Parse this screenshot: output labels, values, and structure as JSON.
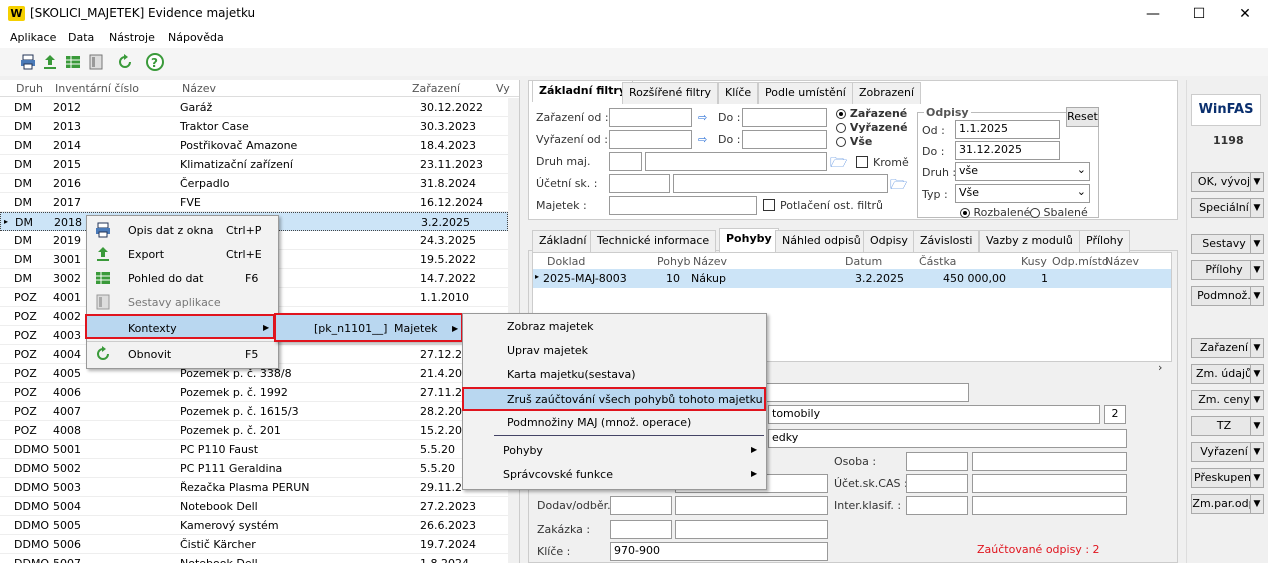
{
  "window": {
    "title": "[SKOLICI_MAJETEK] Evidence majetku",
    "logo_letter": "W",
    "min": "—",
    "max": "☐",
    "close": "✕"
  },
  "menu": [
    "Aplikace",
    "Data",
    "Nástroje",
    "Nápověda"
  ],
  "grid": {
    "headers": [
      "Druh",
      "Inventární číslo",
      "Název",
      "Zařazení",
      "Vy"
    ],
    "rows": [
      [
        "DM",
        "2012",
        "Garáž",
        "30.12.2022"
      ],
      [
        "DM",
        "2013",
        "Traktor Case",
        "30.3.2023"
      ],
      [
        "DM",
        "2014",
        "Postřikovač Amazone",
        "18.4.2023"
      ],
      [
        "DM",
        "2015",
        "Klimatizační zařízení",
        "23.11.2023"
      ],
      [
        "DM",
        "2016",
        "Čerpadlo",
        "31.8.2024"
      ],
      [
        "DM",
        "2017",
        "FVE",
        "16.12.2024"
      ],
      [
        "DM",
        "2018",
        "",
        "3.2.2025"
      ],
      [
        "DM",
        "2019",
        "",
        "24.3.2025"
      ],
      [
        "DM",
        "3001",
        "ndard",
        "19.5.2022"
      ],
      [
        "DM",
        "3002",
        "ook",
        "14.7.2022"
      ],
      [
        "POZ",
        "4001",
        "/1",
        "1.1.2010"
      ],
      [
        "POZ",
        "4002",
        "",
        ""
      ],
      [
        "POZ",
        "4003",
        "",
        ""
      ],
      [
        "POZ",
        "4004",
        "4",
        "27.12.2"
      ],
      [
        "POZ",
        "4005",
        "Pozemek p. č. 338/8",
        "21.4.20"
      ],
      [
        "POZ",
        "4006",
        "Pozemek p. č. 1992",
        "27.11.2"
      ],
      [
        "POZ",
        "4007",
        "Pozemek p. č. 1615/3",
        "28.2.20"
      ],
      [
        "POZ",
        "4008",
        "Pozemek p. č. 201",
        "15.2.20"
      ],
      [
        "DDMO",
        "5001",
        "PC P110 Faust",
        "5.5.20"
      ],
      [
        "DDMO",
        "5002",
        "PC P111 Geraldina",
        "5.5.20"
      ],
      [
        "DDMO",
        "5003",
        "Řezačka Plasma PERUN",
        "29.11.2"
      ],
      [
        "DDMO",
        "5004",
        "Notebook Dell",
        "27.2.2023"
      ],
      [
        "DDMO",
        "5005",
        "Kamerový systém",
        "26.6.2023"
      ],
      [
        "DDMO",
        "5006",
        "Čistič Kärcher",
        "19.7.2024"
      ],
      [
        "DDMO",
        "5007",
        "Notebook Dell",
        "1.8.2024"
      ]
    ]
  },
  "context_menu": {
    "items": [
      {
        "label": "Opis dat z okna",
        "shortcut": "Ctrl+P",
        "icon": "printer-icon"
      },
      {
        "label": "Export",
        "shortcut": "Ctrl+E",
        "icon": "export-icon"
      },
      {
        "label": "Pohled do dat",
        "shortcut": "F6",
        "icon": "table-icon"
      },
      {
        "label": "Sestavy aplikace",
        "shortcut": "",
        "icon": "report-icon"
      },
      {
        "label": "Kontexty",
        "shortcut": "",
        "icon": ""
      },
      {
        "label": "Obnovit",
        "shortcut": "F5",
        "icon": "refresh-icon"
      }
    ],
    "sub1": "[pk_n1101__]",
    "sub1_label": "Majetek",
    "sub2": [
      "Zobraz majetek",
      "Uprav majetek",
      "Karta majetku(sestava)",
      "Zruš zaúčtování všech pohybů tohoto majetku",
      "Podmnožiny MAJ (množ. operace)",
      "Pohyby",
      "Správcovské funkce"
    ]
  },
  "filter_tabs": [
    "Základní filtry",
    "Rozšířené filtry",
    "Klíče",
    "Podle umístění",
    "Zobrazení"
  ],
  "filters": {
    "zarazeni_od": "Zařazení od :",
    "vyrazeni_od": "Vyřazení od :",
    "do": "Do :",
    "druh_maj": "Druh maj.",
    "ucetni_sk": "Účetní sk. :",
    "majetek": "Majetek :",
    "krome": "Kromě",
    "potlaceni": "Potlačení ost. filtrů",
    "radio": [
      "Zařazené",
      "Vyřazené",
      "Vše"
    ],
    "odpisy_title": "Odpisy",
    "reset": "Reset",
    "od": "Od :",
    "od_val": "1.1.2025",
    "do_val": "31.12.2025",
    "druh": "Druh :",
    "druh_val": "vše",
    "typ": "Typ :",
    "typ_val": "Vše",
    "rozbalene": "Rozbalené",
    "sbalene": "Sbalené"
  },
  "detail_tabs": [
    "Základní",
    "Technické informace",
    "Pohyby",
    "Náhled odpisů",
    "Odpisy",
    "Závislosti",
    "Vazby z modulů",
    "Přílohy"
  ],
  "pohyby": {
    "headers": [
      "Doklad",
      "Pohyb",
      "Název",
      "Datum",
      "Částka",
      "Kusy",
      "Odp.místo",
      "Název"
    ],
    "row": [
      "2025-MAJ-8003",
      "10",
      "Nákup",
      "3.2.2025",
      "450 000,00",
      "1",
      "",
      ""
    ]
  },
  "form": {
    "partial1": "tomobily",
    "num": "2",
    "partial2": "edky",
    "osoba": "Osoba :",
    "ucet_cas": "Účet.sk.CAS :",
    "dodav": "Dodav/odběr. :",
    "inter": "Inter.klasif. :",
    "zakazka": "Zakázka :",
    "klice": "Klíče :",
    "klice_val": "970-900",
    "zauct": "Zaúčtované odpisy : 2"
  },
  "right_panel": {
    "brand": "WinFAS",
    "number": "1198",
    "buttons": [
      "OK, vývoj",
      "Speciální",
      "Sestavy",
      "Přílohy",
      "Podmnož.",
      "Zařazení",
      "Zm. údajů",
      "Zm. ceny",
      "TZ",
      "Vyřazení",
      "Přeskupení",
      "Zm.par.odp"
    ]
  },
  "colors": {
    "accent_red": "#e0141e",
    "selection": "#cce4f7",
    "highlight": "#b9d7f0",
    "logo": "#f5d000"
  }
}
